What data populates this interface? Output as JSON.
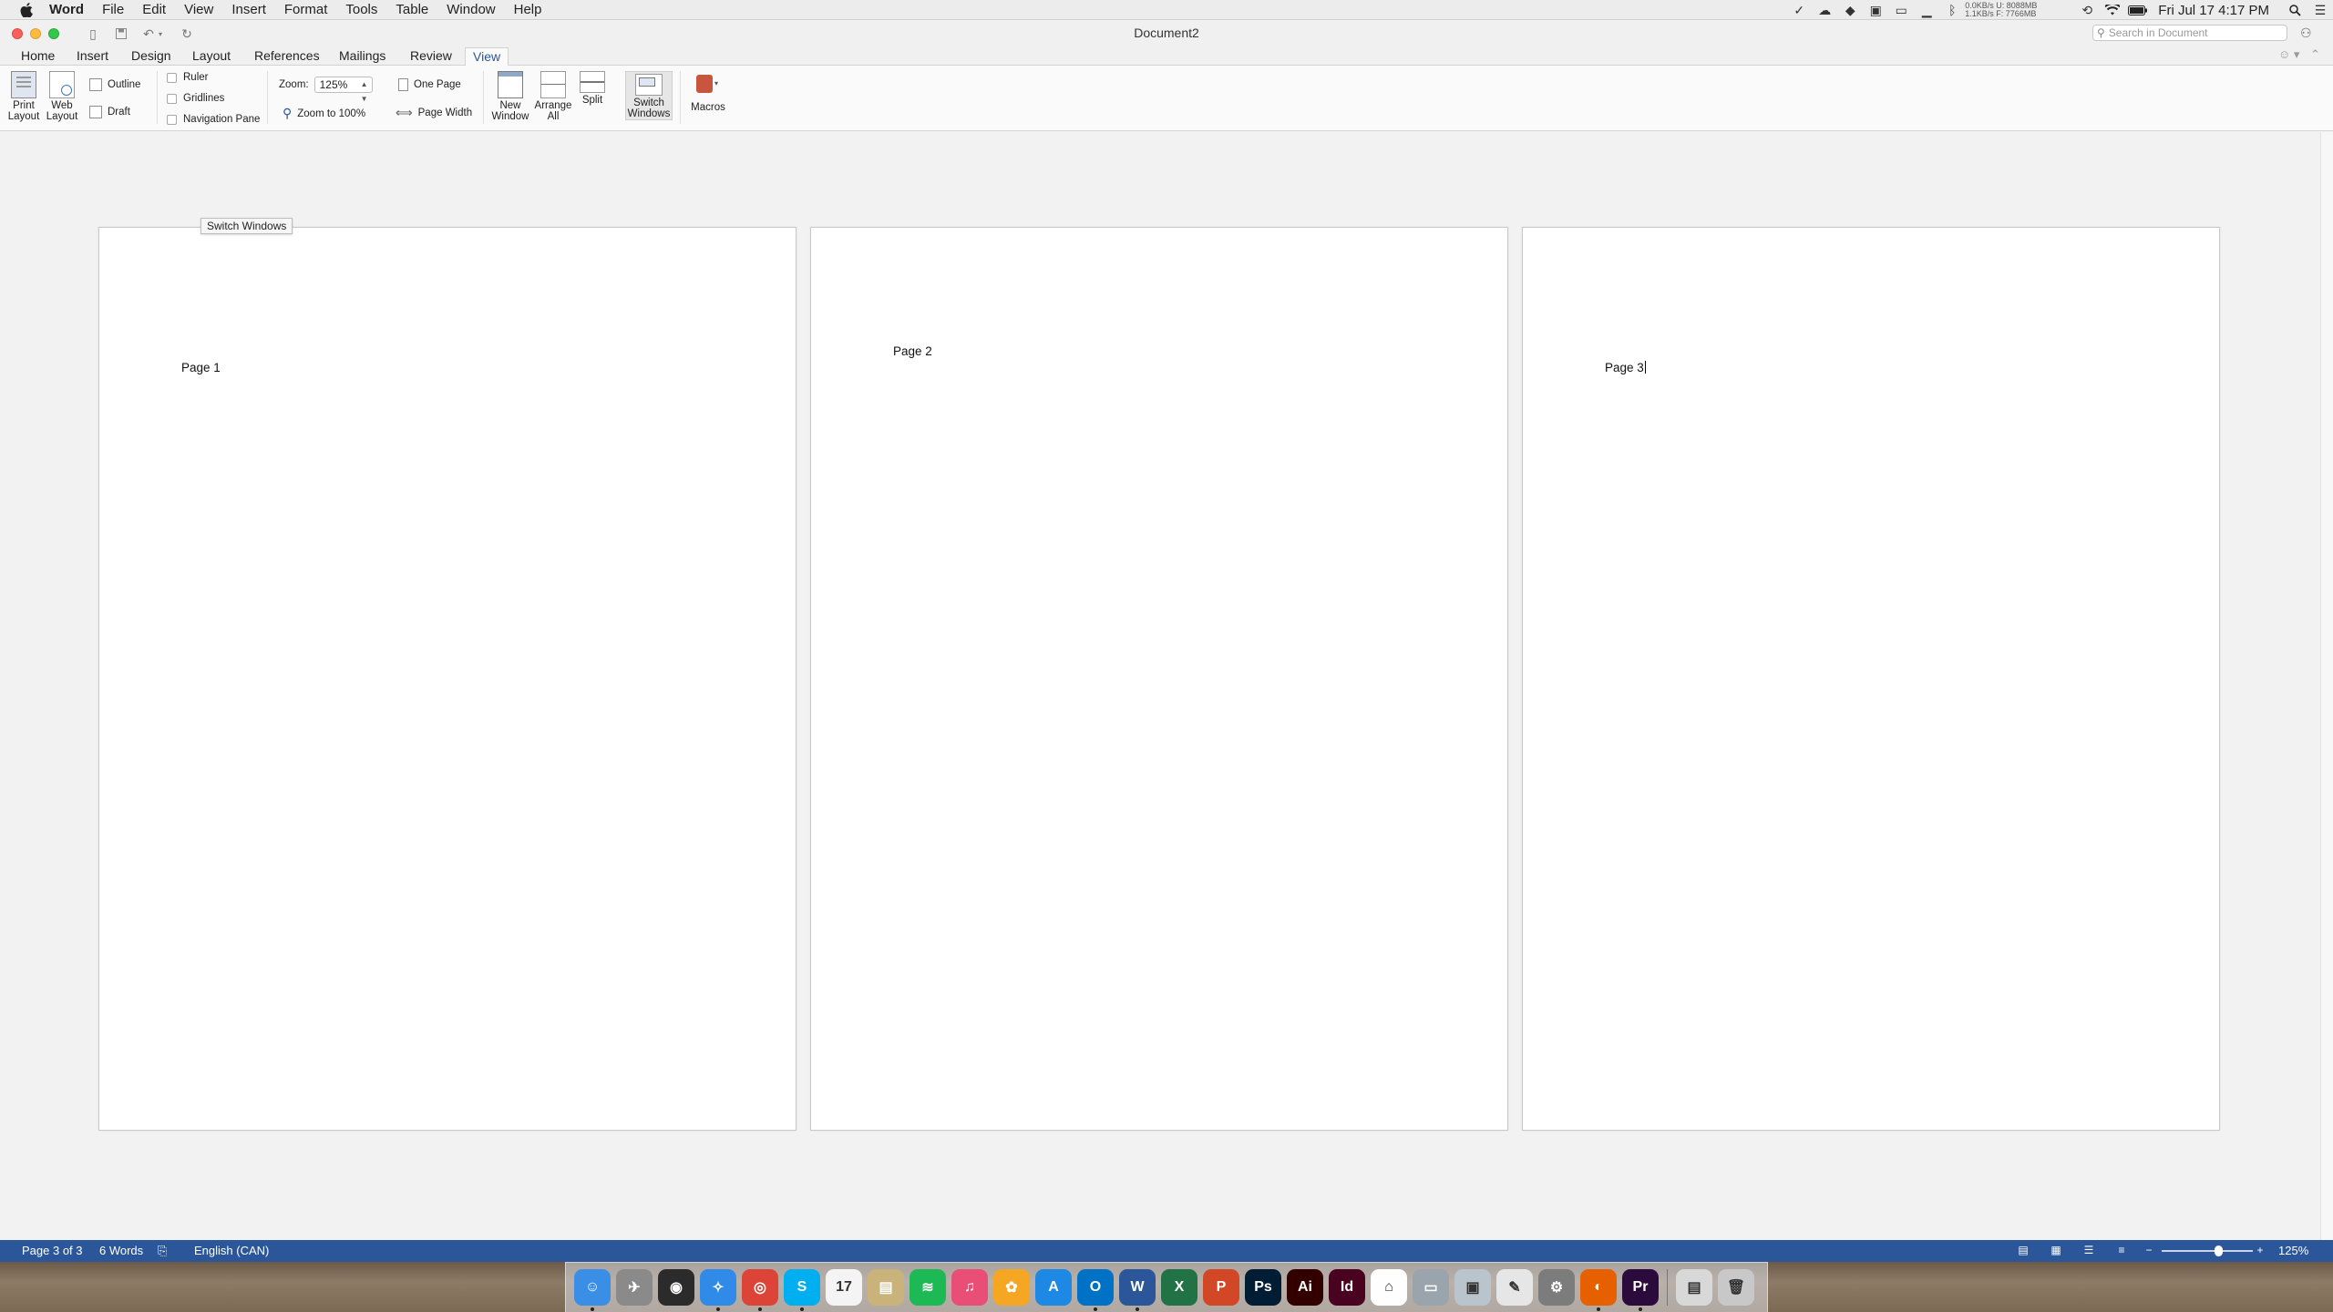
{
  "menubar": {
    "app_name": "Word",
    "items": [
      "File",
      "Edit",
      "View",
      "Insert",
      "Format",
      "Tools",
      "Table",
      "Window",
      "Help"
    ],
    "netstat_line1": "0.0KB/s  U:  8088MB",
    "netstat_line2": "1.1KB/s  F:  7766MB",
    "clock": "Fri Jul 17  4:17 PM"
  },
  "window": {
    "title": "Document2",
    "search_placeholder": "Search in Document"
  },
  "tabs": [
    "Home",
    "Insert",
    "Design",
    "Layout",
    "References",
    "Mailings",
    "Review",
    "View"
  ],
  "active_tab": "View",
  "ribbon": {
    "print_layout": [
      "Print",
      "Layout"
    ],
    "web_layout": [
      "Web",
      "Layout"
    ],
    "outline": "Outline",
    "draft": "Draft",
    "ruler": "Ruler",
    "gridlines": "Gridlines",
    "navigation_pane": "Navigation Pane",
    "zoom_label": "Zoom:",
    "zoom_value": "125%",
    "zoom_100": "Zoom to 100%",
    "one_page": "One Page",
    "page_width": "Page Width",
    "new_window": [
      "New",
      "Window"
    ],
    "arrange_all": [
      "Arrange",
      "All"
    ],
    "split": "Split",
    "switch_windows": [
      "Switch",
      "Windows"
    ],
    "macros": "Macros"
  },
  "tooltip": "Switch Windows",
  "pages": [
    {
      "text": "Page 1"
    },
    {
      "text": "Page 2"
    },
    {
      "text": "Page 3"
    }
  ],
  "statusbar": {
    "page": "Page 3 of 3",
    "words": "6 Words",
    "language": "English (CAN)",
    "zoom": "125%",
    "zoom_fraction": 0.62
  },
  "dock": [
    {
      "name": "Finder",
      "label": "☺",
      "color": "#3a8ee6",
      "running": true
    },
    {
      "name": "Launchpad",
      "label": "✈",
      "color": "#8a8a8a",
      "running": false
    },
    {
      "name": "Mission Control",
      "label": "◉",
      "color": "#2b2b2b",
      "running": false
    },
    {
      "name": "Safari",
      "label": "✧",
      "color": "#2f8ae8",
      "running": true
    },
    {
      "name": "Chrome",
      "label": "◎",
      "color": "#db4437",
      "running": true
    },
    {
      "name": "Skype",
      "label": "S",
      "color": "#00aff0",
      "running": true
    },
    {
      "name": "Calendar",
      "label": "17",
      "color": "#f4f4f4",
      "running": false
    },
    {
      "name": "Notes",
      "label": "▤",
      "color": "#c9b37a",
      "running": false
    },
    {
      "name": "Spotify",
      "label": "≋",
      "color": "#1db954",
      "running": false
    },
    {
      "name": "iTunes",
      "label": "♫",
      "color": "#e94e77",
      "running": false
    },
    {
      "name": "Photos",
      "label": "✿",
      "color": "#f5a623",
      "running": false
    },
    {
      "name": "App Store",
      "label": "A",
      "color": "#1e88e5",
      "running": false
    },
    {
      "name": "Outlook",
      "label": "O",
      "color": "#0072c6",
      "running": true
    },
    {
      "name": "Word",
      "label": "W",
      "color": "#2b579a",
      "running": true
    },
    {
      "name": "Excel",
      "label": "X",
      "color": "#217346",
      "running": false
    },
    {
      "name": "PowerPoint",
      "label": "P",
      "color": "#d24726",
      "running": false
    },
    {
      "name": "Photoshop",
      "label": "Ps",
      "color": "#001d34",
      "running": false
    },
    {
      "name": "Illustrator",
      "label": "Ai",
      "color": "#330000",
      "running": false
    },
    {
      "name": "InDesign",
      "label": "Id",
      "color": "#49021f",
      "running": false
    },
    {
      "name": "Home",
      "label": "⌂",
      "color": "#fefefe",
      "running": false
    },
    {
      "name": "Image Capture",
      "label": "▭",
      "color": "#9aa4ad",
      "running": false
    },
    {
      "name": "Preview",
      "label": "▣",
      "color": "#b9c4cc",
      "running": false
    },
    {
      "name": "TextEdit",
      "label": "✎",
      "color": "#e6e6e6",
      "running": false
    },
    {
      "name": "System Preferences",
      "label": "⚙",
      "color": "#7c7c7c",
      "running": false
    },
    {
      "name": "Firefox",
      "label": "◐",
      "color": "#e66000",
      "running": true
    },
    {
      "name": "Premiere",
      "label": "Pr",
      "color": "#2a0b3c",
      "running": true
    }
  ],
  "dock_right": [
    {
      "name": "Documents",
      "label": "▤",
      "color": "#d8d8d8"
    },
    {
      "name": "Trash",
      "label": "🗑",
      "color": "#c8c8c8"
    }
  ]
}
